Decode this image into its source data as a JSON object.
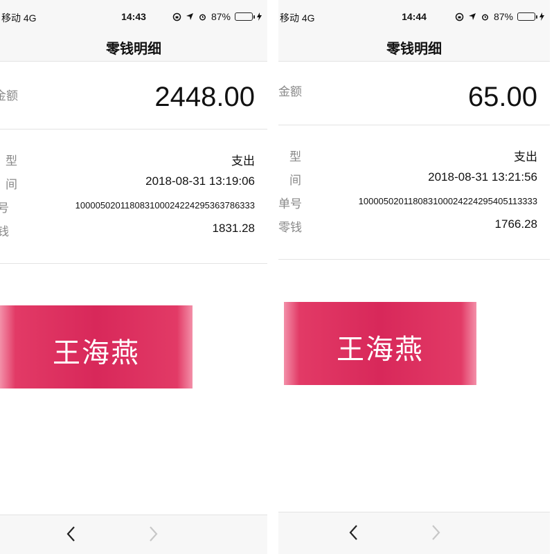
{
  "screens": [
    {
      "status": {
        "carrier": "移动  4G",
        "time": "14:43",
        "battery": "87%",
        "battery_level": 0.87
      },
      "nav_title": "零钱明细",
      "amount": {
        "label": "金额",
        "value": "2448.00"
      },
      "details": [
        {
          "key": "型",
          "value": "支出"
        },
        {
          "key": "间",
          "value": "2018-08-31 13:19:06"
        },
        {
          "key": "号",
          "value": "100005020118083100024224295363786333"
        },
        {
          "key": "钱",
          "value": "1831.28"
        }
      ],
      "stamp_name": "王海燕"
    },
    {
      "status": {
        "carrier": "移动  4G",
        "time": "14:44",
        "battery": "87%",
        "battery_level": 0.87
      },
      "nav_title": "零钱明细",
      "amount": {
        "label": "金额",
        "value": "65.00"
      },
      "details": [
        {
          "key": "型",
          "value": "支出"
        },
        {
          "key": "间",
          "value": "2018-08-31 13:21:56"
        },
        {
          "key": "单号",
          "value": "100005020118083100024224295405113333"
        },
        {
          "key": "零钱",
          "value": "1766.28"
        }
      ],
      "stamp_name": "王海燕"
    }
  ],
  "icons": {
    "status_icons": [
      "orientation-lock-icon",
      "location-arrow-icon",
      "alarm-clock-icon",
      "battery-icon",
      "charging-bolt-icon"
    ],
    "bottom_nav": [
      "back-chevron-icon",
      "forward-chevron-icon"
    ]
  },
  "colors": {
    "stamp": "#d8285a",
    "battery": "#4cd964"
  }
}
